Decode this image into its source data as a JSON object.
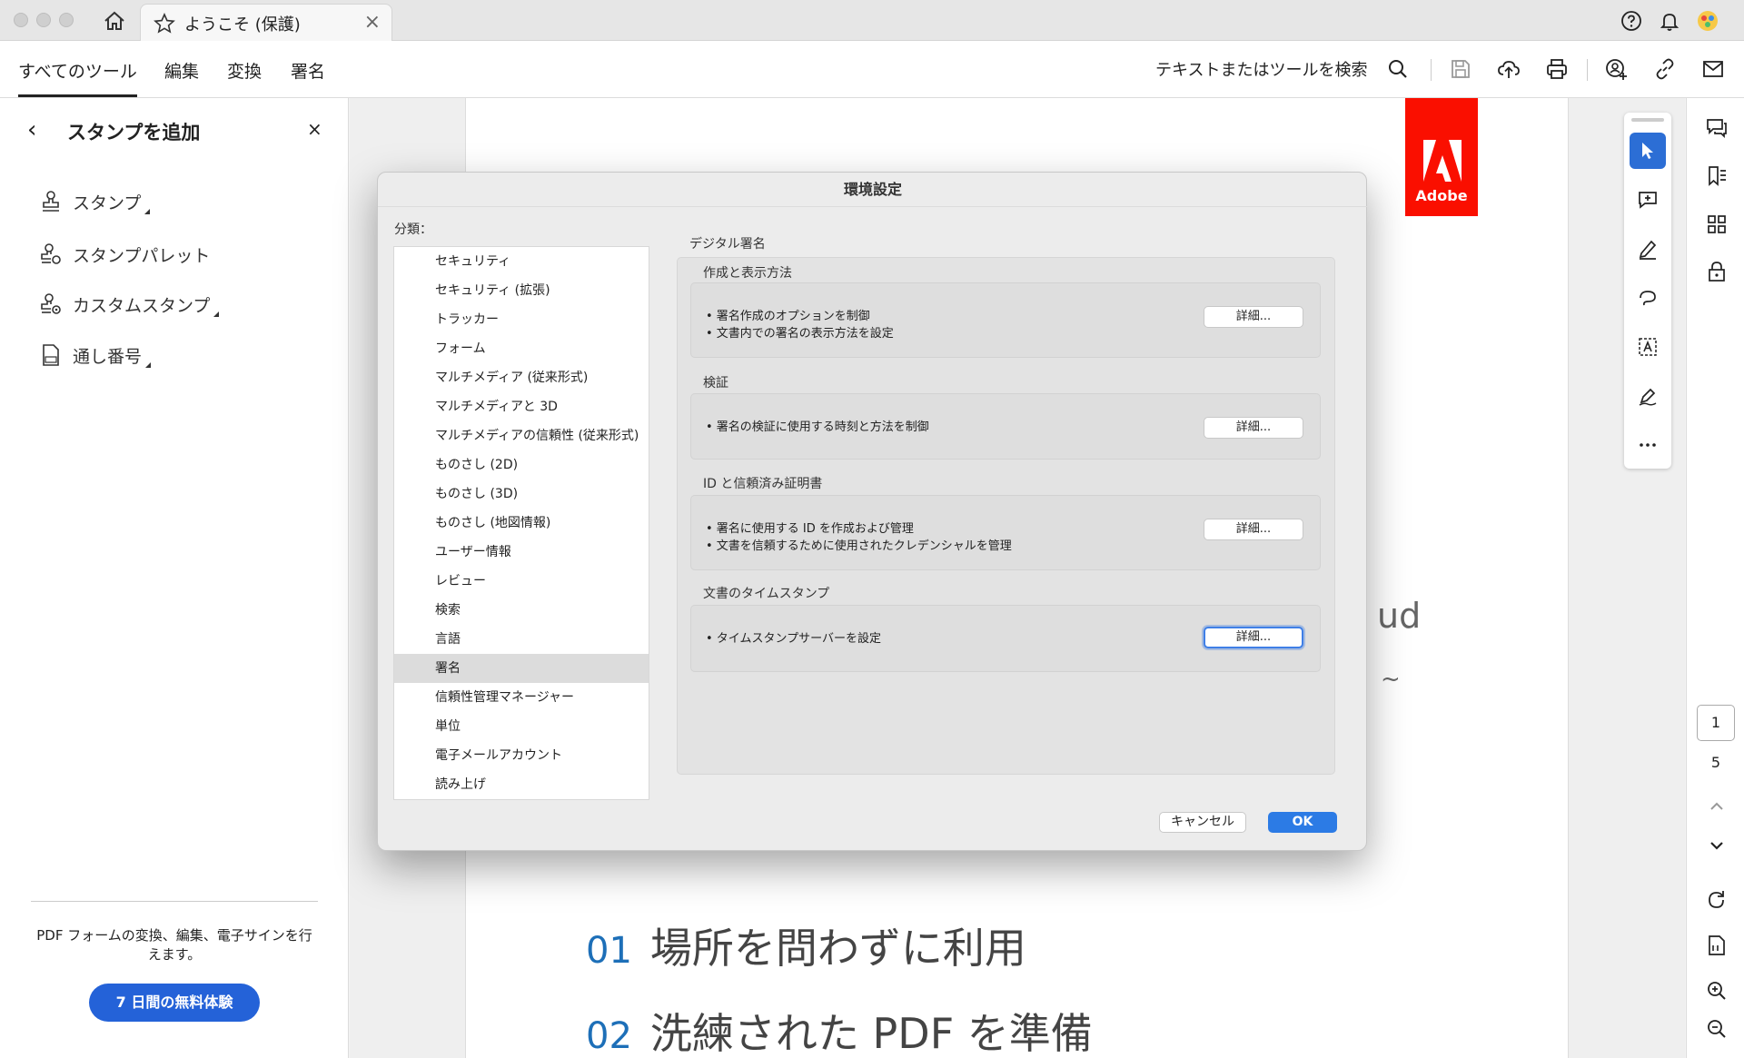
{
  "tab": {
    "title": "ようこそ (保護)",
    "close": "×"
  },
  "menubar": {
    "items": [
      "すべてのツール",
      "編集",
      "変換",
      "署名"
    ],
    "search_label": "テキストまたはツールを検索"
  },
  "left_panel": {
    "back": "‹",
    "title": "スタンプを追加",
    "close": "×",
    "items": [
      {
        "label": "スタンプ",
        "icon": "stamp-icon"
      },
      {
        "label": "スタンプパレット",
        "icon": "stamp-palette-icon"
      },
      {
        "label": "カスタムスタンプ",
        "icon": "custom-stamp-icon"
      },
      {
        "label": "通し番号",
        "icon": "serial-number-icon"
      }
    ],
    "promo": "PDF フォームの変換、編集、電子サインを行えます。",
    "trial_button": "7 日間の無料体験"
  },
  "document": {
    "logo_text": "Adobe",
    "fragment1": "ud",
    "fragment2": "~",
    "lines": [
      {
        "num": "01",
        "text": "場所を問わずに利用"
      },
      {
        "num": "02",
        "text": "洗練された PDF を準備"
      }
    ]
  },
  "right_sidebar": {
    "current_page": "1",
    "total_pages": "5"
  },
  "dialog": {
    "title": "環境設定",
    "category_label": "分類：",
    "categories": [
      "セキュリティ",
      "セキュリティ (拡張)",
      "トラッカー",
      "フォーム",
      "マルチメディア (従来形式)",
      "マルチメディアと 3D",
      "マルチメディアの信頼性 (従来形式)",
      "ものさし (2D)",
      "ものさし (3D)",
      "ものさし (地図情報)",
      "ユーザー情報",
      "レビュー",
      "検索",
      "言語",
      "署名",
      "信頼性管理マネージャー",
      "単位",
      "電子メールアカウント",
      "読み上げ"
    ],
    "selected_category": "署名",
    "section_title": "デジタル署名",
    "groups": [
      {
        "title": "作成と表示方法",
        "lines": [
          "• 署名作成のオプションを制御",
          "• 文書内での署名の表示方法を設定"
        ],
        "button": "詳細..."
      },
      {
        "title": "検証",
        "lines": [
          "• 署名の検証に使用する時刻と方法を制御"
        ],
        "button": "詳細..."
      },
      {
        "title": "ID と信頼済み証明書",
        "lines": [
          "• 署名に使用する ID を作成および管理",
          "• 文書を信頼するために使用されたクレデンシャルを管理"
        ],
        "button": "詳細..."
      },
      {
        "title": "文書のタイムスタンプ",
        "lines": [
          "• タイムスタンプサーバーを設定"
        ],
        "button": "詳細..."
      }
    ],
    "cancel": "キャンセル",
    "ok": "OK"
  },
  "colors": {
    "accent": "#2c7be5",
    "adobe_red": "#fa0f00",
    "trial_blue": "#2462d8"
  }
}
